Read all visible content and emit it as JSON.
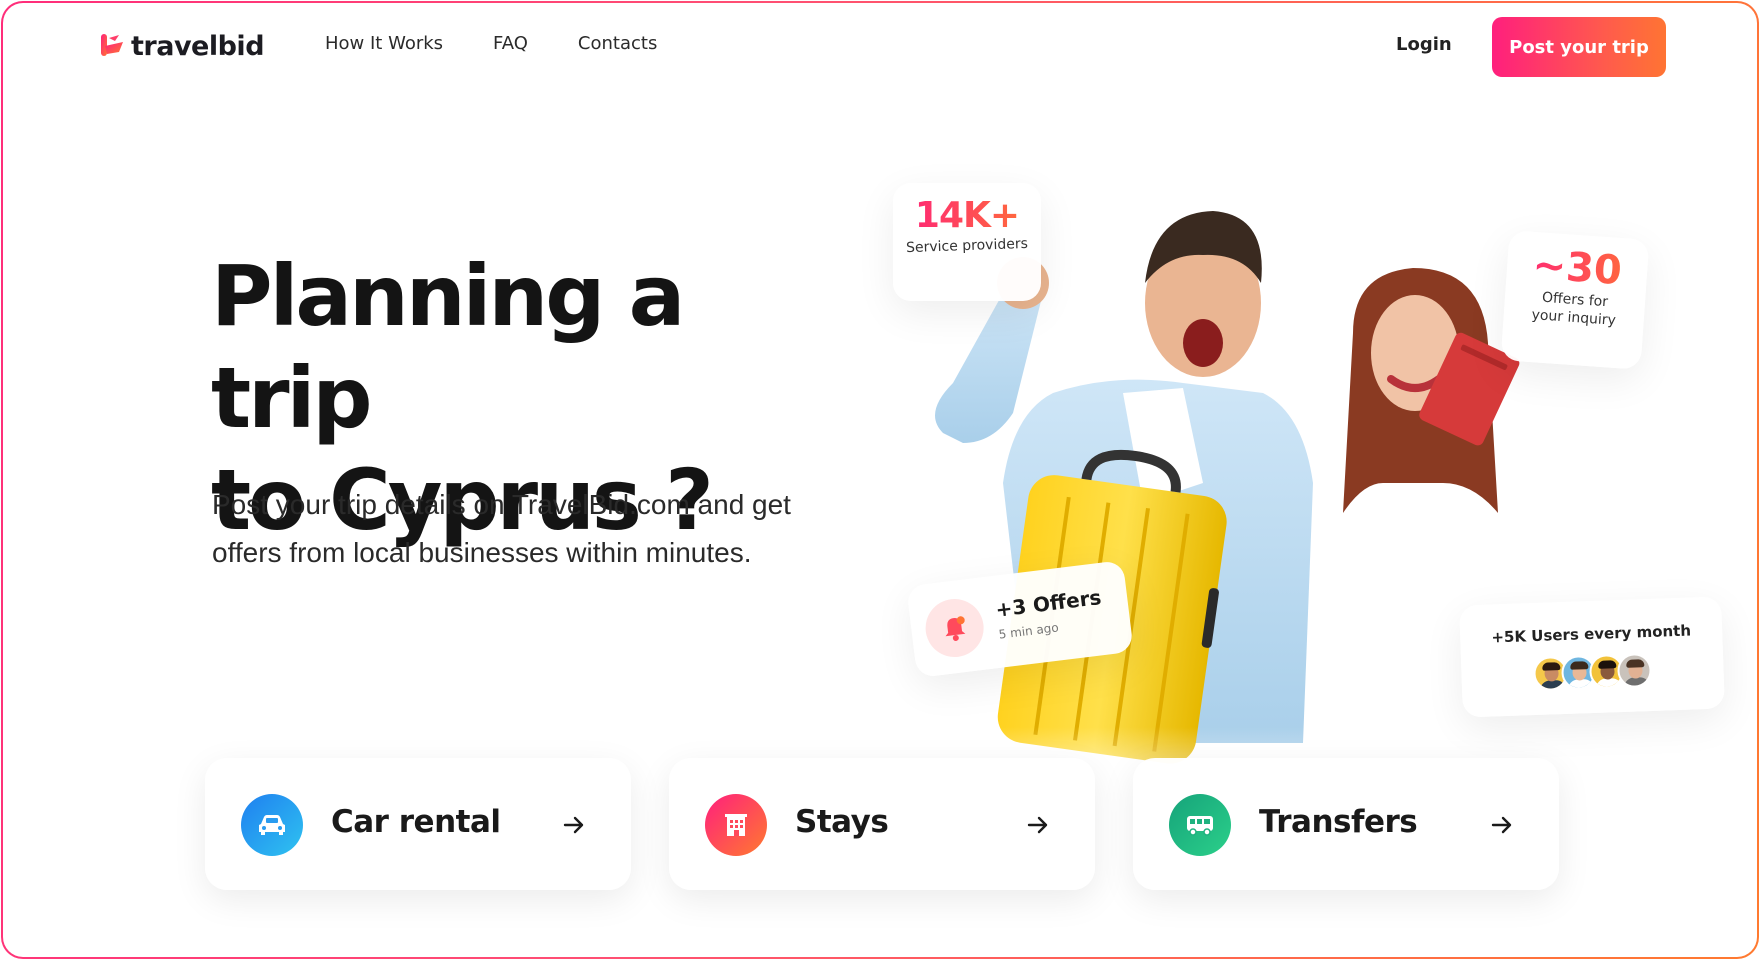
{
  "header": {
    "logo_text": "travelbid",
    "nav": [
      {
        "label": "How It Works"
      },
      {
        "label": "FAQ"
      },
      {
        "label": "Contacts"
      }
    ],
    "login_label": "Login",
    "cta_label": "Post your trip"
  },
  "hero": {
    "title_line1": "Planning a trip",
    "title_line2": "to Cyprus ?",
    "subtitle_line1": "Post your trip details on TravelBid.com and get",
    "subtitle_line2": "offers from local businesses within minutes."
  },
  "stats": {
    "providers": {
      "value": "14K+",
      "label": "Service providers"
    },
    "offers_inquiry": {
      "value": "~30",
      "label_line1": "Offers for",
      "label_line2": "your inquiry"
    },
    "notification": {
      "title": "+3 Offers",
      "time": "5 min ago",
      "icon": "bell-icon"
    },
    "users": {
      "label": "+5K Users every month"
    }
  },
  "categories": [
    {
      "label": "Car rental",
      "icon": "car-icon",
      "color_from": "#1f8ef1",
      "color_to": "#2fc3f0"
    },
    {
      "label": "Stays",
      "icon": "building-icon",
      "color_from": "#ff1f7d",
      "color_to": "#ff7a2f"
    },
    {
      "label": "Transfers",
      "icon": "bus-icon",
      "color_from": "#16a37a",
      "color_to": "#2bd08a"
    }
  ],
  "colors": {
    "brand_from": "#ff1f7d",
    "brand_to": "#ff7433"
  }
}
